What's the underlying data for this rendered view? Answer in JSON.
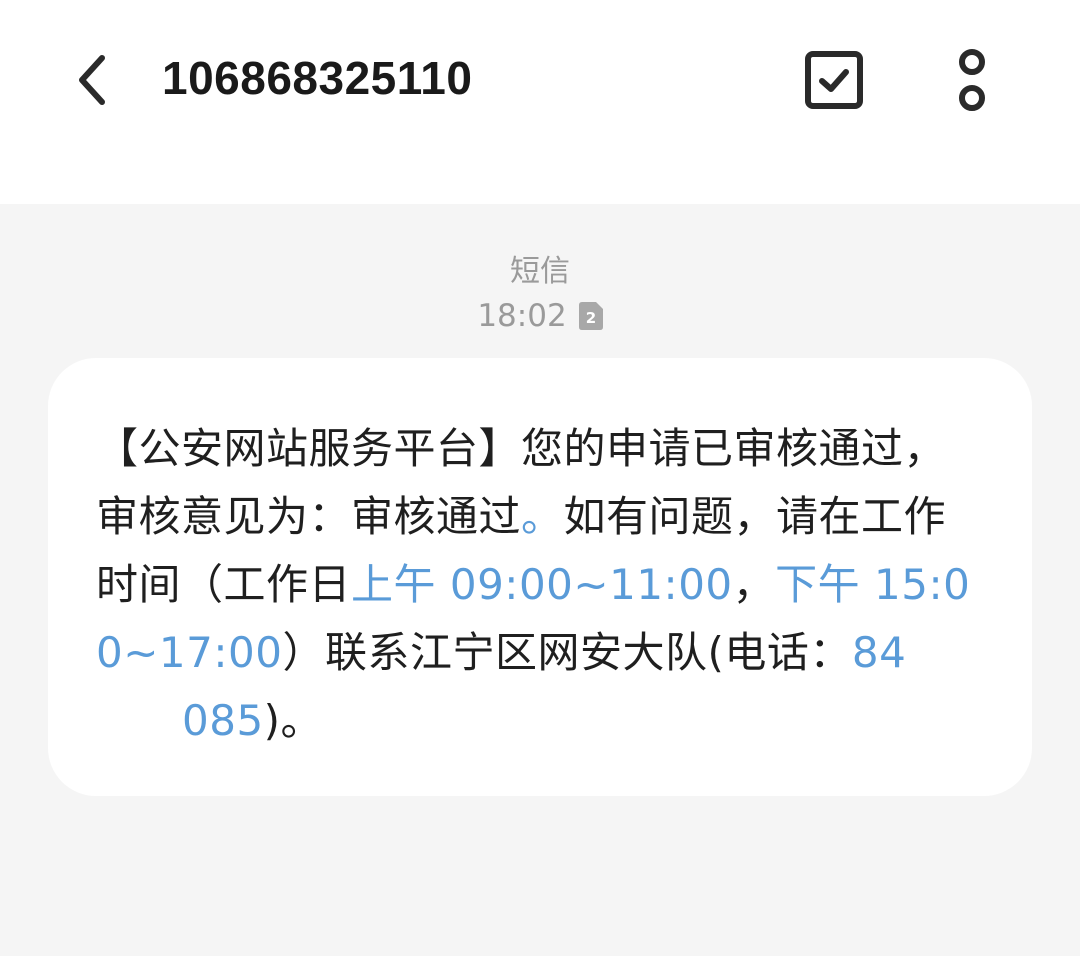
{
  "header": {
    "title": "106868325110",
    "back_icon": "chevron-left-icon",
    "select_icon": "checkbox-icon",
    "more_icon": "more-vertical-icon"
  },
  "meta": {
    "channel": "短信",
    "time": "18:02",
    "sim_slot": "2"
  },
  "message": {
    "line1": "【公安网站服务平台】您的申请已审核通过，审核意见为：审核通过",
    "period_link": "。",
    "part2": "如有问题，请在工作时间（工作日",
    "morning_link": "上午 09:00~11:00",
    "comma": "，",
    "afternoon_link": "下午 15:00~17:00",
    "part3": "）联系江宁区网安大队(电话：",
    "phone_part1": "84",
    "phone_part2": "085",
    "tail": ")。"
  },
  "colors": {
    "link": "#5a9bd8",
    "background": "#f5f5f5",
    "bubble": "#ffffff",
    "meta_text": "#9a9a9a"
  }
}
